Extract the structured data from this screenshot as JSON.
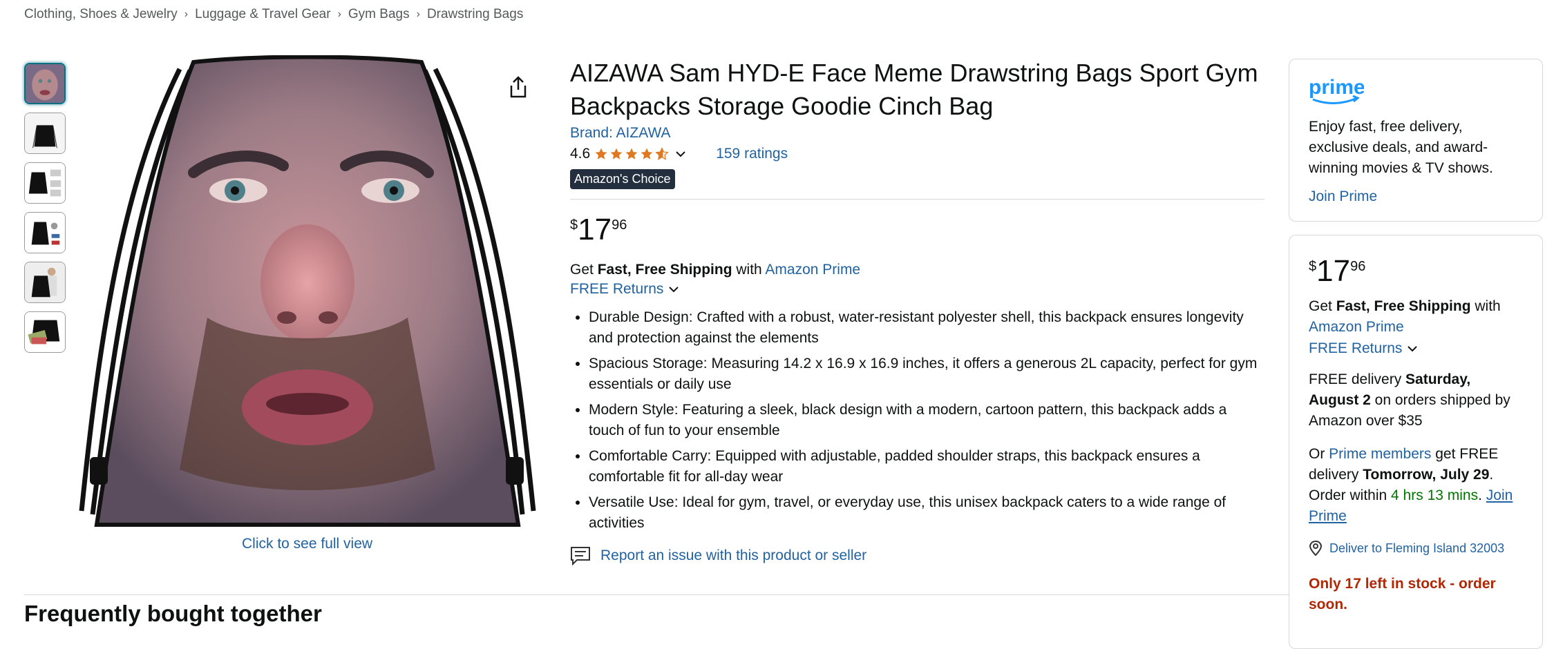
{
  "breadcrumb": [
    "Clothing, Shoes & Jewelry",
    "Luggage & Travel Gear",
    "Gym Bags",
    "Drawstring Bags"
  ],
  "gallery": {
    "thumbnails": [
      "thumb-face",
      "thumb-black-bag",
      "thumb-bag-dimensions",
      "thumb-bag-items",
      "thumb-model",
      "thumb-bag-contents"
    ],
    "full_view_label": "Click to see full view"
  },
  "product": {
    "title": "AIZAWA Sam HYD-E Face Meme Drawstring Bags Sport Gym Backpacks Storage Goodie Cinch Bag",
    "brand": "Brand: AIZAWA",
    "rating": "4.6",
    "stars": 4.6,
    "ratings_count": "159 ratings",
    "badge": "Amazon's Choice",
    "price": {
      "symbol": "$",
      "whole": "17",
      "fraction": "96"
    },
    "shipping": {
      "prefix": "Get ",
      "bold": "Fast, Free Shipping",
      "mid": " with ",
      "link": "Amazon Prime"
    },
    "returns": "FREE Returns",
    "bullets": [
      "Durable Design: Crafted with a robust, water-resistant polyester shell, this backpack ensures longevity and protection against the elements",
      "Spacious Storage: Measuring 14.2 x 16.9 x 16.9 inches, it offers a generous 2L capacity, perfect for gym essentials or daily use",
      "Modern Style: Featuring a sleek, black design with a modern, cartoon pattern, this backpack adds a touch of fun to your ensemble",
      "Comfortable Carry: Equipped with adjustable, padded shoulder straps, this backpack ensures a comfortable fit for all-day wear",
      "Versatile Use: Ideal for gym, travel, or everyday use, this unisex backpack caters to a wide range of activities"
    ],
    "report": "Report an issue with this product or seller"
  },
  "section_heading": "Frequently bought together",
  "prime_box": {
    "logo_text": "prime",
    "text": "Enjoy fast, free delivery, exclusive deals, and award-winning movies & TV shows.",
    "join": "Join Prime"
  },
  "buybox": {
    "price": {
      "symbol": "$",
      "whole": "17",
      "fraction": "96"
    },
    "ship_prefix": "Get ",
    "ship_bold": "Fast, Free Shipping",
    "ship_mid": " with",
    "ship_link": "Amazon Prime",
    "returns": "FREE Returns",
    "delivery_pre": "FREE delivery ",
    "delivery_bold": "Saturday, August 2",
    "delivery_post": " on orders shipped by Amazon over $35",
    "or": "Or ",
    "prime_members": "Prime members",
    "get_free": " get FREE delivery ",
    "tomorrow": "Tomorrow, July 29",
    "order_within": ". Order within ",
    "countdown": "4 hrs 13 mins",
    "period": ". ",
    "join_prime": "Join Prime",
    "deliver_to": "Deliver to Fleming Island 32003",
    "stock": "Only 17 left in stock - order soon."
  },
  "colors": {
    "link": "#2162a1",
    "star": "#de7921",
    "badge": "#232f3e",
    "stock": "#b12704",
    "green": "#007600",
    "prime": "#1a98ff"
  }
}
